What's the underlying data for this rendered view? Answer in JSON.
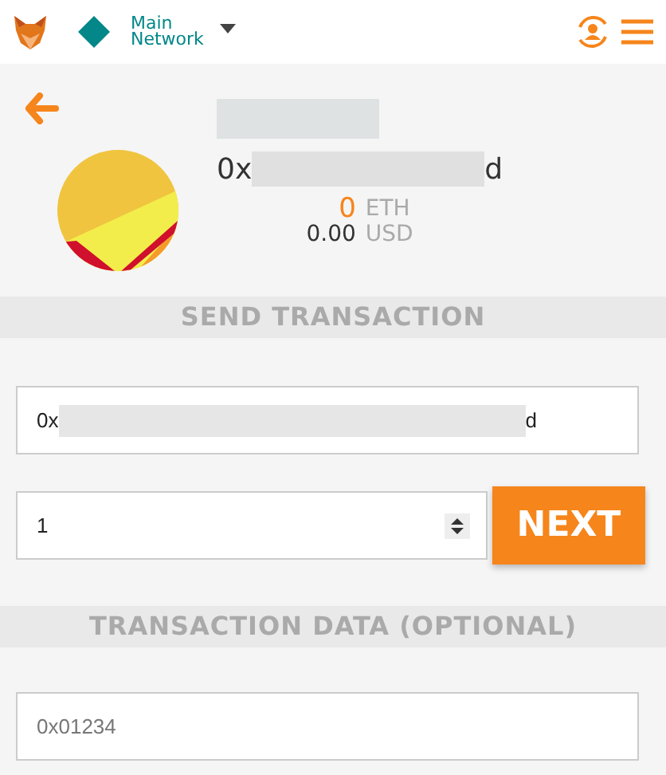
{
  "header": {
    "network": "Main\nNetwork"
  },
  "account": {
    "address_start": "0x",
    "address_end": "d",
    "balance": "0",
    "balance_unit": "ETH",
    "fiat": "0.00",
    "fiat_unit": "USD"
  },
  "send_section": {
    "title": "SEND TRANSACTION"
  },
  "recipient": {
    "value_start": "0x",
    "value_end": "d"
  },
  "amount": {
    "value": "1"
  },
  "next_button": "NEXT",
  "data_section": {
    "title": "TRANSACTION DATA (OPTIONAL)"
  },
  "data_field": {
    "placeholder": "0x01234"
  }
}
